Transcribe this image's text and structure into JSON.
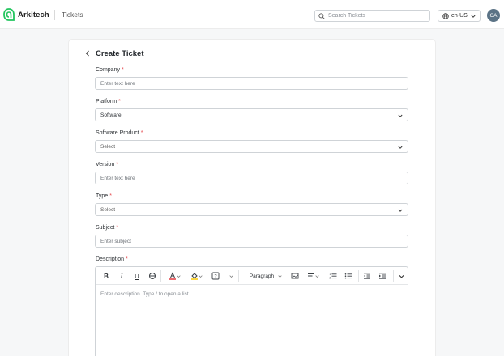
{
  "app": {
    "brand": "Arkitech",
    "breadcrumb": "Tickets",
    "search_placeholder": "Search Tickets",
    "locale": "en-US",
    "user_initials": "CA",
    "colors": {
      "brand": "#22c55e",
      "required": "#e5484d",
      "avatar": "#5b7386"
    }
  },
  "form": {
    "title": "Create Ticket",
    "required_marker": "*",
    "company": {
      "label": "Company",
      "placeholder": "Enter text here",
      "value": ""
    },
    "platform": {
      "label": "Platform",
      "value": "Software"
    },
    "software_product": {
      "label": "Software Product",
      "value": "Select"
    },
    "version": {
      "label": "Version",
      "placeholder": "Enter text here",
      "value": ""
    },
    "type": {
      "label": "Type",
      "value": "Select"
    },
    "subject": {
      "label": "Subject",
      "placeholder": "Enter subject",
      "value": ""
    },
    "description": {
      "label": "Description",
      "placeholder": "Enter description. Type / to open a list",
      "toolbar": {
        "bold": "B",
        "italic": "I",
        "underline": "U",
        "strike": "S",
        "paragraph_style": "Paragraph",
        "icons": [
          "bold-icon",
          "italic-icon",
          "underline-icon",
          "strikethrough-icon",
          "text-color-icon",
          "highlight-icon",
          "special-char-icon",
          "more-icon",
          "paragraph-dropdown",
          "image-icon",
          "align-icon",
          "numbered-list-icon",
          "bullet-list-icon",
          "outdent-icon",
          "indent-icon",
          "expand-toolbar-icon"
        ]
      }
    }
  }
}
